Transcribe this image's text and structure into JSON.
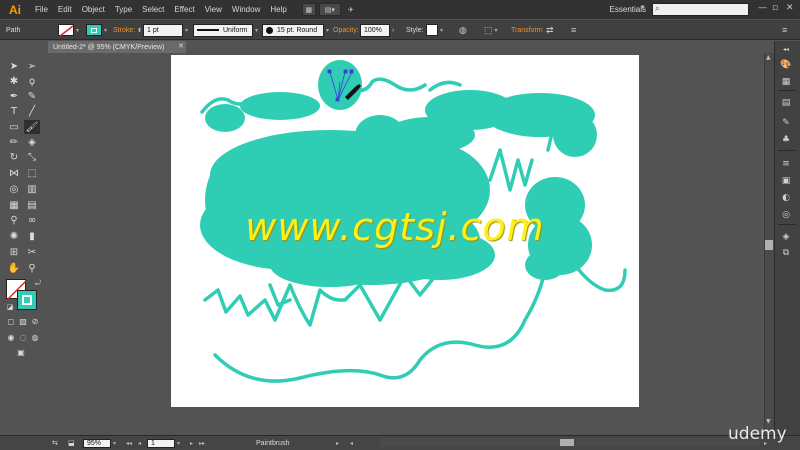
{
  "app": {
    "logo": "Ai",
    "menus": [
      "File",
      "Edit",
      "Object",
      "Type",
      "Select",
      "Effect",
      "View",
      "Window",
      "Help"
    ],
    "workspace": "Essentials",
    "search_placeholder": ""
  },
  "control_bar": {
    "selection_type": "Path",
    "stroke_label": "Stroke:",
    "stroke_weight": "1 pt",
    "profile": "Uniform",
    "brush": "15 pt. Round",
    "opacity_label": "Opacity:",
    "opacity_value": "100%",
    "style_label": "Style:",
    "transform_label": "Transform"
  },
  "document": {
    "tab_title": "Untitled-2* @ 95% (CMYK/Preview)"
  },
  "status_bar": {
    "zoom": "95%",
    "artboard_number": "1",
    "current_tool": "Paintbrush"
  },
  "watermark": "www.cgtsj.com",
  "brand": "udemy",
  "colors": {
    "fill_color": "#2ecdb4",
    "stroke_color": "#ffffff",
    "accent_orange": "#f0922b",
    "watermark_yellow": "#ffef19"
  },
  "icons": {
    "tools": [
      "selection-tool-icon",
      "direct-selection-tool-icon",
      "magic-wand-tool-icon",
      "lasso-tool-icon",
      "pen-tool-icon",
      "curvature-tool-icon",
      "type-tool-icon",
      "line-segment-tool-icon",
      "rectangle-tool-icon",
      "paintbrush-tool-icon",
      "pencil-tool-icon",
      "eraser-tool-icon",
      "rotate-tool-icon",
      "scale-tool-icon",
      "width-tool-icon",
      "free-transform-tool-icon",
      "shape-builder-tool-icon",
      "perspective-grid-tool-icon",
      "mesh-tool-icon",
      "gradient-tool-icon",
      "eyedropper-tool-icon",
      "blend-tool-icon",
      "symbol-sprayer-tool-icon",
      "column-graph-tool-icon",
      "artboard-tool-icon",
      "slice-tool-icon",
      "hand-tool-icon",
      "zoom-tool-icon"
    ]
  }
}
